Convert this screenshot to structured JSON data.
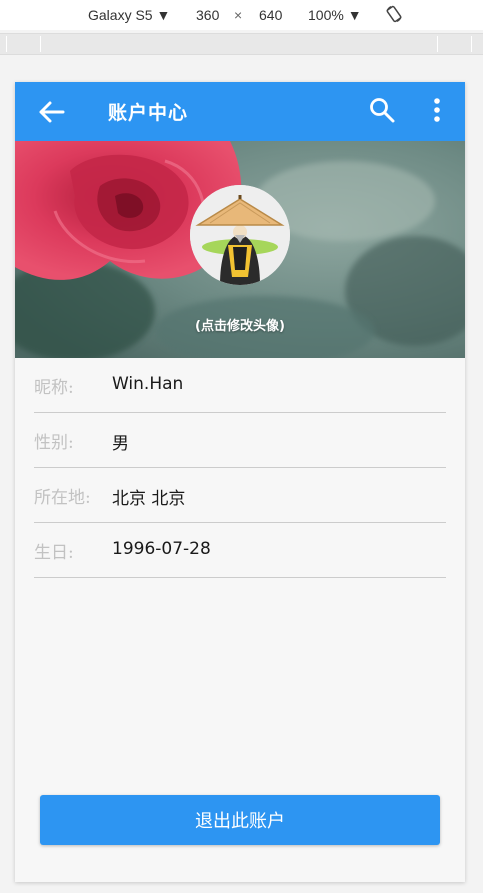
{
  "devtools": {
    "device": "Galaxy S5",
    "width": "360",
    "times": "×",
    "height": "640",
    "zoom": "100%",
    "device_menu_icon": "caret-down-icon",
    "zoom_menu_icon": "caret-down-icon",
    "rotate_icon": "rotate-icon"
  },
  "appbar": {
    "title": "账户中心",
    "back_icon": "arrow-left-icon",
    "search_icon": "search-icon",
    "more_icon": "more-vertical-icon",
    "color": "#2d95f2"
  },
  "profile": {
    "avatar_caption": "(点击修改头像)"
  },
  "info": [
    {
      "label": "昵称:",
      "value": "Win.Han"
    },
    {
      "label": "性别:",
      "value": "男"
    },
    {
      "label": "所在地:",
      "value": "北京 北京"
    },
    {
      "label": "生日:",
      "value": "1996-07-28"
    }
  ],
  "logout_label": "退出此账户"
}
